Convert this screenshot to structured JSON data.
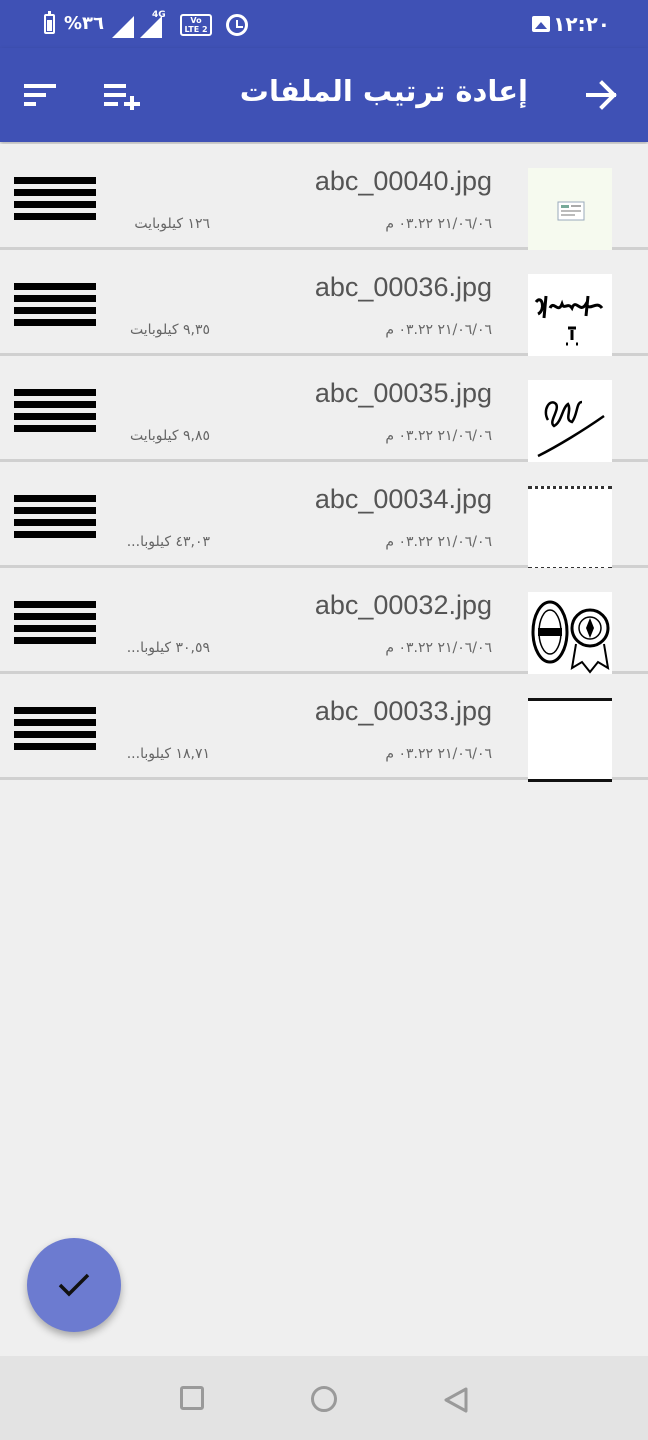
{
  "status_bar": {
    "time": "١٢:٢٠",
    "battery_percent": "%٣٦",
    "network_label": "4G",
    "volte_label": "Vo LTE 2"
  },
  "app_bar": {
    "title": "إعادة ترتيب الملفات",
    "icons": [
      "back-arrow-icon",
      "add-to-list-icon",
      "sort-icon"
    ]
  },
  "files": [
    {
      "name": "abc_00040.jpg",
      "date": "٢١/٠٦/٠٦ ٠٣.٢٢ م",
      "size": "١٢٦ كيلوبايت",
      "thumb": "document-card"
    },
    {
      "name": "abc_00036.jpg",
      "date": "٢١/٠٦/٠٦ ٠٣.٢٢ م",
      "size": "٩,٣٥ كيلوبايت",
      "thumb": "signature"
    },
    {
      "name": "abc_00035.jpg",
      "date": "٢١/٠٦/٠٦ ٠٣.٢٢ م",
      "size": "٩,٨٥ كيلوبايت",
      "thumb": "signature"
    },
    {
      "name": "abc_00034.jpg",
      "date": "٢١/٠٦/٠٦ ٠٣.٢٢ م",
      "size": "٤٣,٠٣ كيلوبا...",
      "thumb": "blank-dotted"
    },
    {
      "name": "abc_00032.jpg",
      "date": "٢١/٠٦/٠٦ ٠٣.٢٢ م",
      "size": "٣٠,٥٩ كيلوبا...",
      "thumb": "seals"
    },
    {
      "name": "abc_00033.jpg",
      "date": "٢١/٠٦/٠٦ ٠٣.٢٢ م",
      "size": "١٨,٧١ كيلوبا...",
      "thumb": "blank-lined"
    }
  ],
  "fab": {
    "icon": "check-icon"
  },
  "colors": {
    "primary": "#3f51b5",
    "fab": "#6c7bd0",
    "background": "#efefef"
  }
}
